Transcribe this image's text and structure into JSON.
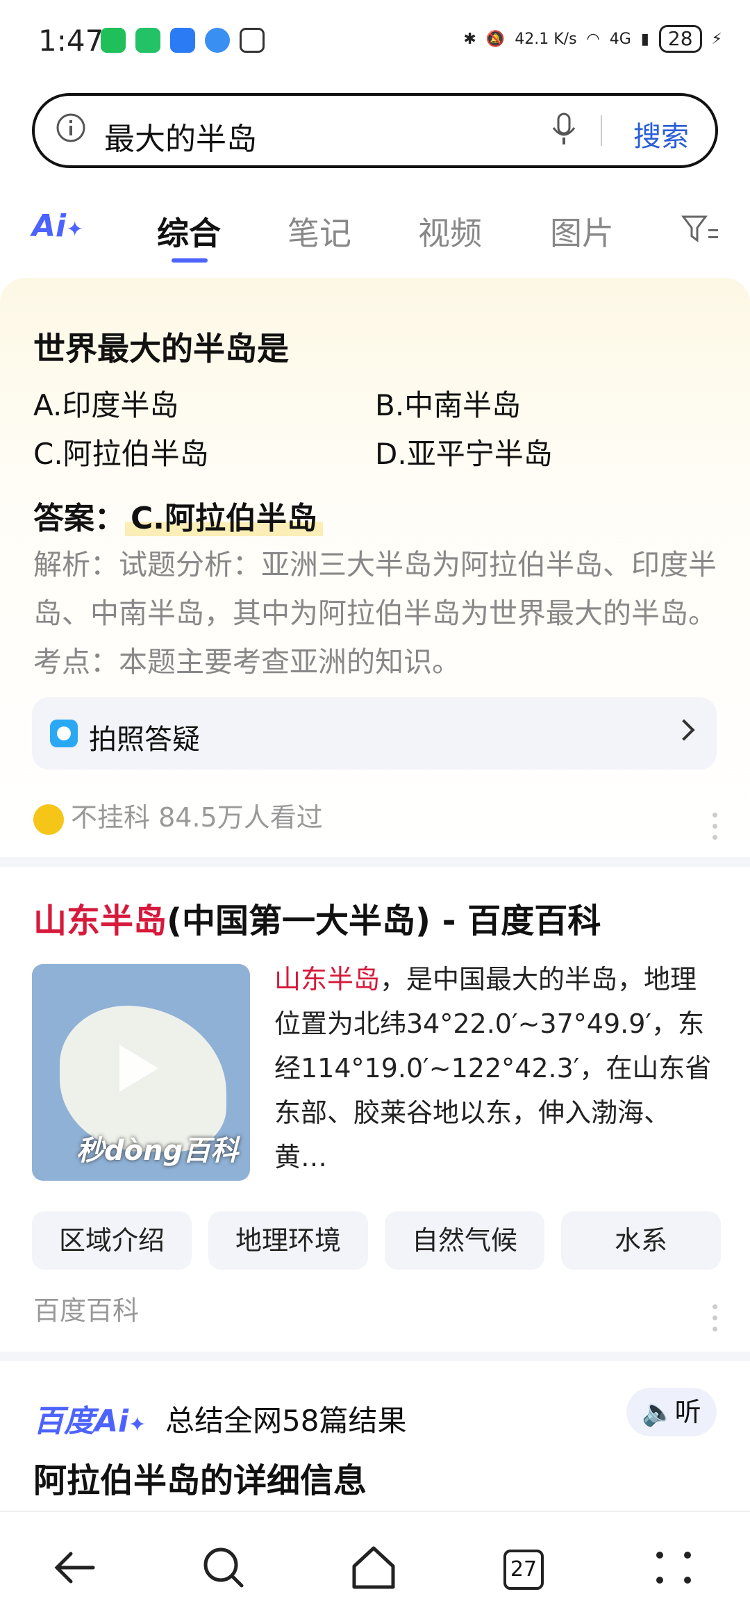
{
  "status_bar": {
    "time": "1:47",
    "net_speed": "42.1 K/s",
    "network": "4G",
    "battery": "28",
    "app_icon_colors": [
      "#1fbf5a",
      "#23c267",
      "#2a7bf4",
      "#3a8ff3"
    ]
  },
  "search": {
    "query": "最大的半岛",
    "button": "搜索"
  },
  "tabs": {
    "ai": "Ai",
    "items": [
      "综合",
      "笔记",
      "视频",
      "图片"
    ],
    "active": "综合",
    "accent": "#4d63ff"
  },
  "answer_card": {
    "question": "世界最大的半岛是",
    "options": [
      "A.印度半岛",
      "B.中南半岛",
      "C.阿拉伯半岛",
      "D.亚平宁半岛"
    ],
    "answer_label": "答案：",
    "answer_value": "C.阿拉伯半岛",
    "analysis": "解析：试题分析：亚洲三大半岛为阿拉伯半岛、印度半岛、中南半岛，其中为阿拉伯半岛为世界最大的半岛。考点：本题主要考查亚洲的知识。",
    "photo_qa": "拍照答疑",
    "source_name": "不挂科",
    "views": "84.5万人看过"
  },
  "baike_card": {
    "title_highlight": "山东半岛",
    "title_rest": "(中国第一大半岛) - 百度百科",
    "thumbnail_watermark": "秒dòng百科",
    "desc_highlight": "山东半岛",
    "desc_rest": "，是中国最大的半岛，地理位置为北纬34°22.0′~37°49.9′，东经114°19.0′~122°42.3′，在山东省东部、胶莱谷地以东，伸入渤海、黄…",
    "chips": [
      "区域介绍",
      "地理环境",
      "自然气候",
      "水系"
    ],
    "source": "百度百科",
    "highlight_color": "#d7193b"
  },
  "ai_summary": {
    "brand": "百度Ai",
    "summary": "总结全网58篇结果",
    "listen": "听",
    "headline": "阿拉伯半岛的详细信息"
  },
  "bottom_nav": {
    "tab_count": "27",
    "icons": [
      "back-icon",
      "search-icon",
      "home-icon",
      "tabs-icon",
      "more-icon"
    ]
  }
}
